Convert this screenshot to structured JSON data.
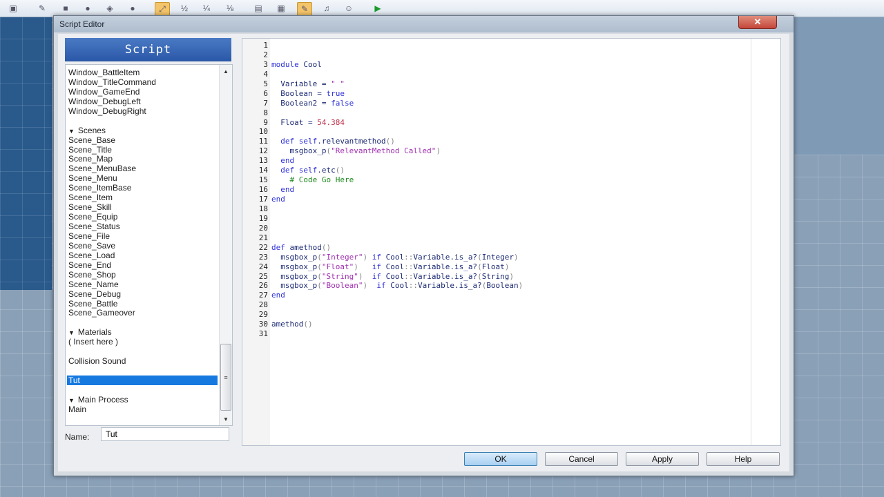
{
  "window": {
    "title": "Script Editor",
    "close_icon": "close-icon"
  },
  "toolbar": {
    "icons": [
      "new-icon",
      "open-icon",
      "pencil-icon",
      "rectangle-icon",
      "ellipse-icon",
      "flood-fill-icon",
      "shadow-pen-icon",
      "select-icon",
      "layer-icon",
      "zoom-100-icon",
      "zoom-50-icon",
      "zoom-25-icon",
      "database-icon",
      "material-icon",
      "script-icon",
      "sound-icon",
      "character-icon",
      "playtest-icon"
    ]
  },
  "sidebar": {
    "header": "Script",
    "items": [
      {
        "label": "Window_BattleItem",
        "kind": "item"
      },
      {
        "label": "Window_TitleCommand",
        "kind": "item"
      },
      {
        "label": "Window_GameEnd",
        "kind": "item"
      },
      {
        "label": "Window_DebugLeft",
        "kind": "item"
      },
      {
        "label": "Window_DebugRight",
        "kind": "item"
      },
      {
        "label": "",
        "kind": "gap"
      },
      {
        "label": "Scenes",
        "kind": "section"
      },
      {
        "label": "Scene_Base",
        "kind": "item"
      },
      {
        "label": "Scene_Title",
        "kind": "item"
      },
      {
        "label": "Scene_Map",
        "kind": "item"
      },
      {
        "label": "Scene_MenuBase",
        "kind": "item"
      },
      {
        "label": "Scene_Menu",
        "kind": "item"
      },
      {
        "label": "Scene_ItemBase",
        "kind": "item"
      },
      {
        "label": "Scene_Item",
        "kind": "item"
      },
      {
        "label": "Scene_Skill",
        "kind": "item"
      },
      {
        "label": "Scene_Equip",
        "kind": "item"
      },
      {
        "label": "Scene_Status",
        "kind": "item"
      },
      {
        "label": "Scene_File",
        "kind": "item"
      },
      {
        "label": "Scene_Save",
        "kind": "item"
      },
      {
        "label": "Scene_Load",
        "kind": "item"
      },
      {
        "label": "Scene_End",
        "kind": "item"
      },
      {
        "label": "Scene_Shop",
        "kind": "item"
      },
      {
        "label": "Scene_Name",
        "kind": "item"
      },
      {
        "label": "Scene_Debug",
        "kind": "item"
      },
      {
        "label": "Scene_Battle",
        "kind": "item"
      },
      {
        "label": "Scene_Gameover",
        "kind": "item"
      },
      {
        "label": "",
        "kind": "gap"
      },
      {
        "label": "Materials",
        "kind": "section"
      },
      {
        "label": "( Insert here )",
        "kind": "item"
      },
      {
        "label": "",
        "kind": "gap"
      },
      {
        "label": "Collision Sound",
        "kind": "item"
      },
      {
        "label": "",
        "kind": "gap"
      },
      {
        "label": "Tut",
        "kind": "selected"
      },
      {
        "label": "",
        "kind": "gap"
      },
      {
        "label": "Main Process",
        "kind": "section"
      },
      {
        "label": "Main",
        "kind": "item"
      }
    ],
    "name_label": "Name:",
    "name_value": "Tut"
  },
  "code": {
    "lines": [
      [],
      [],
      [
        [
          "kw",
          "module"
        ],
        [
          "tx",
          " Cool"
        ]
      ],
      [],
      [
        [
          "tx",
          "  Variable = "
        ],
        [
          "str",
          "\" \""
        ]
      ],
      [
        [
          "tx",
          "  Boolean = "
        ],
        [
          "kw",
          "true"
        ]
      ],
      [
        [
          "tx",
          "  Boolean2 = "
        ],
        [
          "kw",
          "false"
        ]
      ],
      [],
      [
        [
          "tx",
          "  Float = "
        ],
        [
          "num",
          "54.384"
        ]
      ],
      [],
      [
        [
          "kw",
          "  def"
        ],
        [
          "tx",
          " "
        ],
        [
          "kw",
          "self"
        ],
        [
          "tx",
          ".relevantmethod"
        ],
        [
          "par",
          "()"
        ]
      ],
      [
        [
          "tx",
          "    msgbox_p"
        ],
        [
          "par",
          "("
        ],
        [
          "str",
          "\"RelevantMethod Called\""
        ],
        [
          "par",
          ")"
        ]
      ],
      [
        [
          "kw",
          "  end"
        ]
      ],
      [
        [
          "kw",
          "  def"
        ],
        [
          "tx",
          " "
        ],
        [
          "kw",
          "self"
        ],
        [
          "tx",
          ".etc"
        ],
        [
          "par",
          "()"
        ]
      ],
      [
        [
          "cm",
          "    # Code Go Here"
        ]
      ],
      [
        [
          "kw",
          "  end"
        ]
      ],
      [
        [
          "kw",
          "end"
        ]
      ],
      [],
      [],
      [],
      [],
      [
        [
          "kw",
          "def"
        ],
        [
          "tx",
          " amethod"
        ],
        [
          "par",
          "()"
        ]
      ],
      [
        [
          "tx",
          "  msgbox_p"
        ],
        [
          "par",
          "("
        ],
        [
          "str",
          "\"Integer\""
        ],
        [
          "par",
          ")"
        ],
        [
          "tx",
          " "
        ],
        [
          "kw",
          "if"
        ],
        [
          "tx",
          " Cool"
        ],
        [
          "par",
          "::"
        ],
        [
          "tx",
          "Variable.is_a?"
        ],
        [
          "par",
          "("
        ],
        [
          "tx",
          "Integer"
        ],
        [
          "par",
          ")"
        ]
      ],
      [
        [
          "tx",
          "  msgbox_p"
        ],
        [
          "par",
          "("
        ],
        [
          "str",
          "\"Float\""
        ],
        [
          "par",
          ")"
        ],
        [
          "tx",
          "   "
        ],
        [
          "kw",
          "if"
        ],
        [
          "tx",
          " Cool"
        ],
        [
          "par",
          "::"
        ],
        [
          "tx",
          "Variable.is_a?"
        ],
        [
          "par",
          "("
        ],
        [
          "tx",
          "Float"
        ],
        [
          "par",
          ")"
        ]
      ],
      [
        [
          "tx",
          "  msgbox_p"
        ],
        [
          "par",
          "("
        ],
        [
          "str",
          "\"String\""
        ],
        [
          "par",
          ")"
        ],
        [
          "tx",
          "  "
        ],
        [
          "kw",
          "if"
        ],
        [
          "tx",
          " Cool"
        ],
        [
          "par",
          "::"
        ],
        [
          "tx",
          "Variable.is_a?"
        ],
        [
          "par",
          "("
        ],
        [
          "tx",
          "String"
        ],
        [
          "par",
          ")"
        ]
      ],
      [
        [
          "tx",
          "  msgbox_p"
        ],
        [
          "par",
          "("
        ],
        [
          "str",
          "\"Boolean\""
        ],
        [
          "par",
          ")"
        ],
        [
          "tx",
          "  "
        ],
        [
          "kw",
          "if"
        ],
        [
          "tx",
          " Cool"
        ],
        [
          "par",
          "::"
        ],
        [
          "tx",
          "Variable.is_a?"
        ],
        [
          "par",
          "("
        ],
        [
          "tx",
          "Boolean"
        ],
        [
          "par",
          ")"
        ]
      ],
      [
        [
          "kw",
          "end"
        ]
      ],
      [],
      [],
      [
        [
          "tx",
          "amethod"
        ],
        [
          "par",
          "()"
        ]
      ],
      []
    ]
  },
  "buttons": {
    "ok": "OK",
    "cancel": "Cancel",
    "apply": "Apply",
    "help": "Help"
  }
}
